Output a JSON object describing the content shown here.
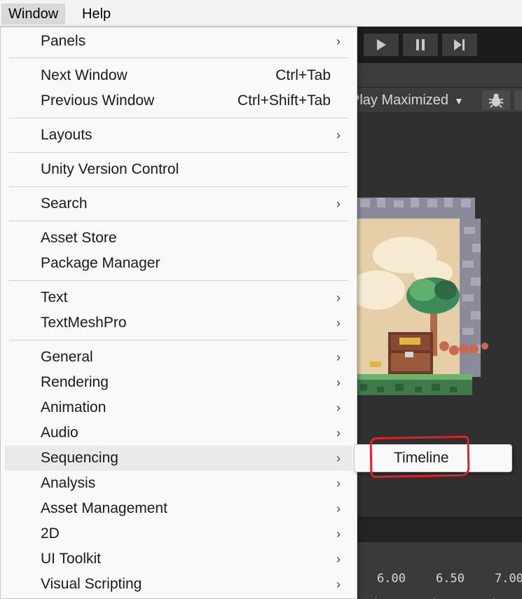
{
  "menubar": {
    "items": [
      "Window",
      "Help"
    ]
  },
  "window_menu": {
    "items": [
      {
        "label": "Panels",
        "submenu": true
      },
      {
        "label": "Next Window",
        "shortcut": "Ctrl+Tab"
      },
      {
        "label": "Previous Window",
        "shortcut": "Ctrl+Shift+Tab"
      },
      {
        "label": "Layouts",
        "submenu": true
      },
      {
        "label": "Unity Version Control"
      },
      {
        "label": "Search",
        "submenu": true
      },
      {
        "label": "Asset Store"
      },
      {
        "label": "Package Manager"
      },
      {
        "label": "Text",
        "submenu": true
      },
      {
        "label": "TextMeshPro",
        "submenu": true
      },
      {
        "label": "General",
        "submenu": true
      },
      {
        "label": "Rendering",
        "submenu": true
      },
      {
        "label": "Animation",
        "submenu": true
      },
      {
        "label": "Audio",
        "submenu": true
      },
      {
        "label": "Sequencing",
        "submenu": true,
        "highlighted": true
      },
      {
        "label": "Analysis",
        "submenu": true
      },
      {
        "label": "Asset Management",
        "submenu": true
      },
      {
        "label": "2D",
        "submenu": true
      },
      {
        "label": "UI Toolkit",
        "submenu": true
      },
      {
        "label": "Visual Scripting",
        "submenu": true
      }
    ]
  },
  "sequencing_submenu": {
    "items": [
      "Timeline"
    ]
  },
  "game_toolbar": {
    "play_mode": "Play Maximized"
  },
  "timeline_ruler": {
    "ticks": [
      "6.00",
      "6.50",
      "7.00"
    ]
  },
  "annotation": {
    "color": "#e0202a"
  }
}
